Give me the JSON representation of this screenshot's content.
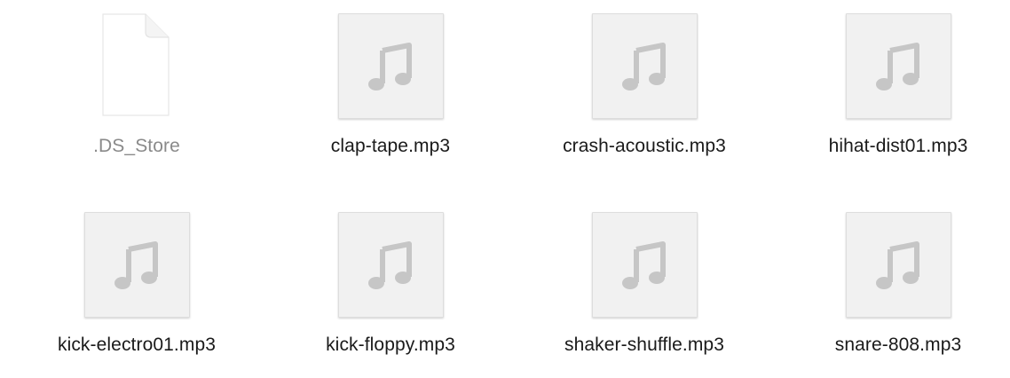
{
  "window": {
    "view": "icon-grid"
  },
  "files": [
    {
      "name": ".DS_Store",
      "kind": "generic-document",
      "icon": "blank-document-icon",
      "hidden": true
    },
    {
      "name": "clap-tape.mp3",
      "kind": "audio",
      "icon": "music-note-icon",
      "hidden": false
    },
    {
      "name": "crash-acoustic.mp3",
      "kind": "audio",
      "icon": "music-note-icon",
      "hidden": false
    },
    {
      "name": "hihat-dist01.mp3",
      "kind": "audio",
      "icon": "music-note-icon",
      "hidden": false
    },
    {
      "name": "kick-electro01.mp3",
      "kind": "audio",
      "icon": "music-note-icon",
      "hidden": false
    },
    {
      "name": "kick-floppy.mp3",
      "kind": "audio",
      "icon": "music-note-icon",
      "hidden": false
    },
    {
      "name": "shaker-shuffle.mp3",
      "kind": "audio",
      "icon": "music-note-icon",
      "hidden": false
    },
    {
      "name": "snare-808.mp3",
      "kind": "audio",
      "icon": "music-note-icon",
      "hidden": false
    }
  ],
  "colors": {
    "label_text": "#1a1a1a",
    "hidden_label_text": "#8a8a8a",
    "thumbnail_fill": "#f1f1f1",
    "music_note": "#c6c6c6"
  }
}
